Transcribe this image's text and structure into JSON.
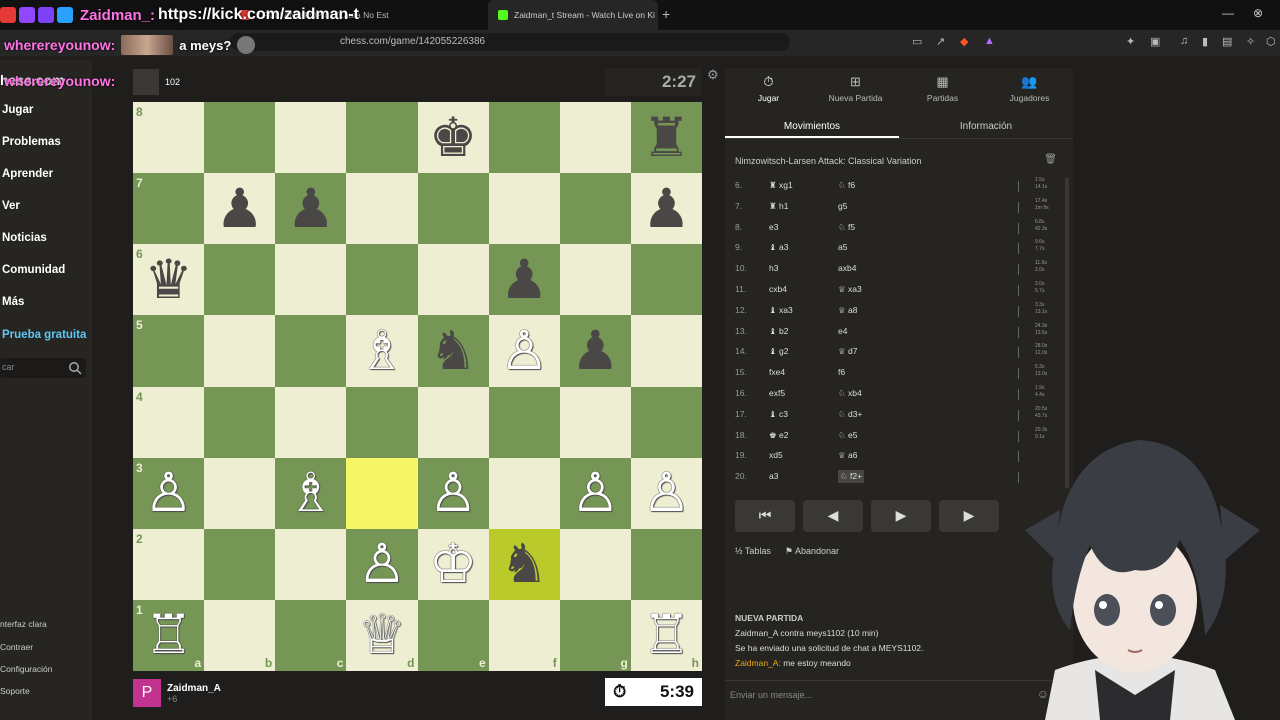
{
  "browser": {
    "tabs": [
      {
        "label": "2 PULI AND POP #1 (Laura No Est",
        "fav_color": "#e53935"
      },
      {
        "label": "Zaidman_t Stream - Watch Live on Ki",
        "fav_color": "#53fc18"
      }
    ],
    "new_tab": "+",
    "url": "chess.com/game/142055226386",
    "window_min": "—",
    "window_close": "⊗"
  },
  "overlay": {
    "line1_user": "Zaidman_:",
    "line1_msg": "https://kick.com/zaidman-t",
    "line2_user": "wherereyounow:",
    "line2_msg": "a meys?",
    "line3_user": "wherereyounow:",
    "badge_colors": [
      "#e53935",
      "#9146ff",
      "#7b42f6",
      "#2aa1ff"
    ]
  },
  "nav": {
    "logo": "hess.com",
    "items": [
      "Jugar",
      "Problemas",
      "Aprender",
      "Ver",
      "Noticias",
      "Comunidad",
      "Más"
    ],
    "trial": "Prueba gratuita",
    "search_placeholder": "car",
    "bottom": [
      "nterfaz clara",
      "Contraer",
      "Configuración",
      "Soporte"
    ]
  },
  "game": {
    "top_player": {
      "rating": "102",
      "clock": "2:27"
    },
    "bottom_player": {
      "name": "Zaidman_A",
      "avatar_letter": "P",
      "material": "+6",
      "clock": "5:39"
    },
    "board": [
      [
        "",
        "",
        "",
        "",
        "bk",
        "",
        "",
        "br"
      ],
      [
        "",
        "bp",
        "bp",
        "",
        "",
        "",
        "",
        "bp"
      ],
      [
        "bq",
        "",
        "",
        "",
        "",
        "bp",
        "",
        ""
      ],
      [
        "",
        "",
        "",
        "wb",
        "bn",
        "wp",
        "bp",
        ""
      ],
      [
        "",
        "",
        "",
        "",
        "",
        "",
        "",
        ""
      ],
      [
        "wp",
        "",
        "wb",
        "hl",
        "wp",
        "",
        "wp",
        "wp"
      ],
      [
        "",
        "",
        "",
        "wp",
        "wk",
        "bnhl",
        "",
        ""
      ],
      [
        "wr",
        "",
        "",
        "wq",
        "",
        "",
        "",
        "wr"
      ]
    ],
    "ranks": [
      "8",
      "7",
      "6",
      "5",
      "4",
      "3",
      "2",
      "1"
    ],
    "files": [
      "a",
      "b",
      "c",
      "d",
      "e",
      "f",
      "g",
      "h"
    ]
  },
  "panel": {
    "tabs": [
      {
        "label": "Jugar",
        "icon": "⏱"
      },
      {
        "label": "Nueva Partida",
        "icon": "⊞"
      },
      {
        "label": "Partidas",
        "icon": "▦"
      },
      {
        "label": "Jugadores",
        "icon": "👥"
      }
    ],
    "subtabs": [
      "Movimientos",
      "Información"
    ],
    "opening": "Nimzowitsch-Larsen Attack: Classical Variation",
    "moves": [
      {
        "n": "6.",
        "w": "♜ xg1",
        "b": "♘ f6",
        "tw": "1.5s",
        "tb": "14.1s"
      },
      {
        "n": "7.",
        "w": "♜ h1",
        "b": "g5",
        "tw": "17.4s",
        "tb": "1m 9s"
      },
      {
        "n": "8.",
        "w": "e3",
        "b": "♘ f5",
        "tw": "6.8s",
        "tb": "42.3s"
      },
      {
        "n": "9.",
        "w": "♝ a3",
        "b": "a5",
        "tw": "9.6s",
        "tb": "7.7s"
      },
      {
        "n": "10.",
        "w": "h3",
        "b": "axb4",
        "tw": "11.6s",
        "tb": "2.0s"
      },
      {
        "n": "11.",
        "w": "cxb4",
        "b": "♕ xa3",
        "tw": "3.0s",
        "tb": "5.7s"
      },
      {
        "n": "12.",
        "w": "♝ xa3",
        "b": "♕ a8",
        "tw": "3.3s",
        "tb": "13.1s"
      },
      {
        "n": "13.",
        "w": "♝ b2",
        "b": "e4",
        "tw": "24.3s",
        "tb": "13.6s"
      },
      {
        "n": "14.",
        "w": "♝ g2",
        "b": "♕ d7",
        "tw": "28.0s",
        "tb": "12.0s"
      },
      {
        "n": "15.",
        "w": "fxe4",
        "b": "f6",
        "tw": "5.3s",
        "tb": "13.0s"
      },
      {
        "n": "16.",
        "w": "exf5",
        "b": "♘ xb4",
        "tw": "1.9s",
        "tb": "4.4s"
      },
      {
        "n": "17.",
        "w": "♝ c3",
        "b": "♘ d3+",
        "tw": "20.5s",
        "tb": "43.7s"
      },
      {
        "n": "18.",
        "w": "♚ e2",
        "b": "♘ e5",
        "tw": "20.3s",
        "tb": "9.1s"
      },
      {
        "n": "19.",
        "w": "xd5",
        "b": "♕ a6",
        "tw": "",
        "tb": ""
      },
      {
        "n": "20.",
        "w": "a3",
        "b": "♘ f2+",
        "tw": "",
        "tb": ""
      }
    ],
    "controls": [
      "⏮",
      "◀",
      "▶",
      "▶"
    ],
    "draw": "Tablas",
    "resign": "Abandonar",
    "chat": {
      "heading": "NUEVA PARTIDA",
      "line1": "Zaidman_A contra meys1102 (10 min)",
      "line2": "Se ha enviado una solicitud de chat a MEYS1102.",
      "user": "Zaidman_A:",
      "msg": "me estoy meando"
    },
    "chat_placeholder": "Enviar un mensaje..."
  },
  "colors": {
    "light": "#eeeed2",
    "dark": "#769656",
    "accent": "#5fc7f5"
  }
}
